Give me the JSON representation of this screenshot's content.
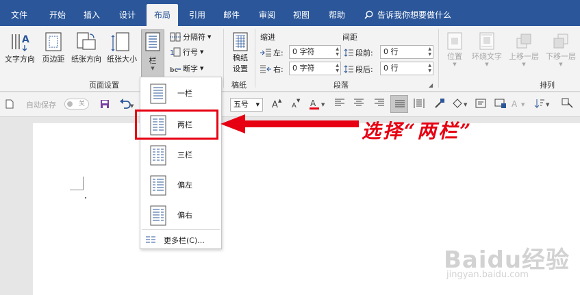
{
  "tabs": [
    "文件",
    "开始",
    "插入",
    "设计",
    "布局",
    "引用",
    "邮件",
    "审阅",
    "视图",
    "帮助"
  ],
  "tell_me": "告诉我你想要做什么",
  "ribbon": {
    "page_setup": {
      "text_direction": "文字方向",
      "margins": "页边距",
      "orientation": "纸张方向",
      "size": "纸张大小",
      "columns": "栏",
      "breaks": "分隔符",
      "line_numbers": "行号",
      "hyphenation": "断字",
      "group_label": "页面设置"
    },
    "manuscript": {
      "button_line1": "稿纸",
      "button_line2": "设置",
      "group_label": "稿纸"
    },
    "paragraph": {
      "indent_title": "缩进",
      "spacing_title": "间距",
      "left_label": "左:",
      "right_label": "右:",
      "before_label": "段前:",
      "after_label": "段后:",
      "left_value": "0 字符",
      "right_value": "0 字符",
      "before_value": "0 行",
      "after_value": "0 行",
      "group_label": "段落"
    },
    "arrange": {
      "position": "位置",
      "wrap_text": "环绕文字",
      "bring_forward": "上移一层",
      "send_backward": "下移一层",
      "group_label": "排列"
    }
  },
  "qat": {
    "autosave": "自动保存",
    "toggle": "关",
    "font_size": "五号"
  },
  "dropdown": {
    "items": [
      "一栏",
      "两栏",
      "三栏",
      "偏左",
      "偏右"
    ],
    "more": "更多栏(C)..."
  },
  "annotation": "选择“两栏”",
  "watermark": {
    "brand": "Baidu经验",
    "url": "jingyan.baidu.com"
  },
  "colors": {
    "tab_bar": "#2b579a",
    "highlight": "#e60012"
  }
}
